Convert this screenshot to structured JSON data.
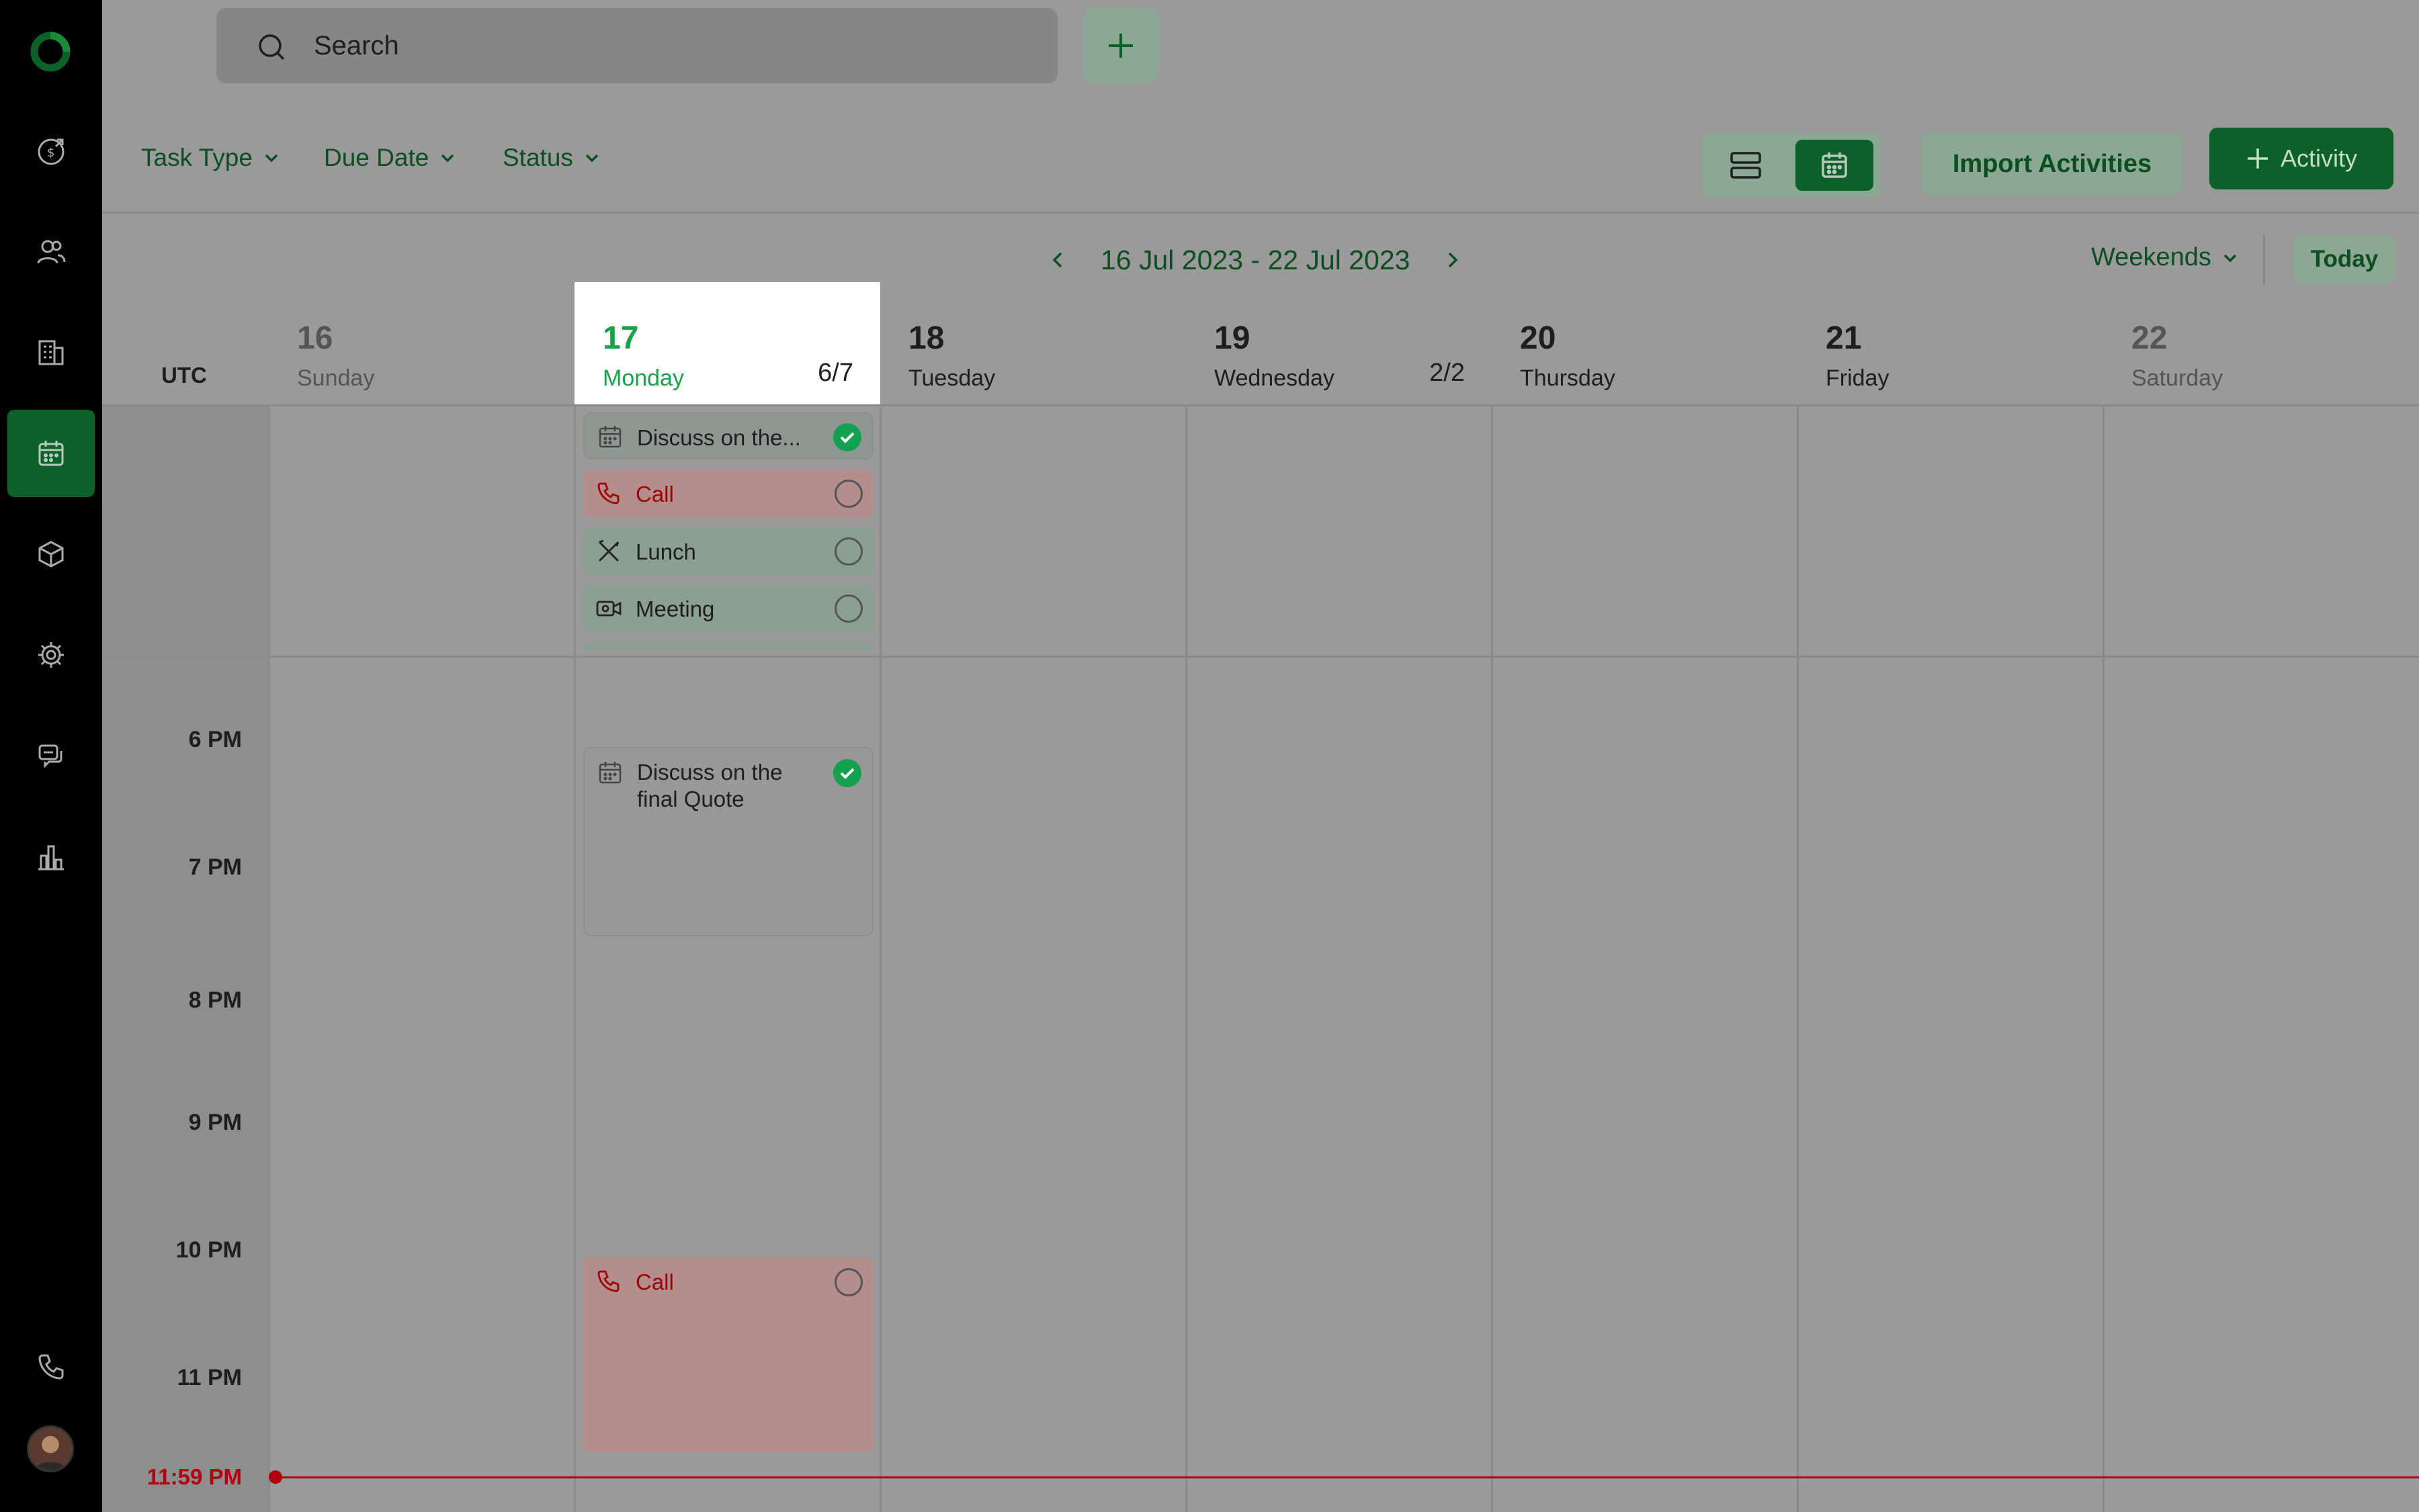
{
  "search": {
    "placeholder": "Search"
  },
  "filters": {
    "task_type": "Task Type",
    "due_date": "Due Date",
    "status": "Status"
  },
  "actions": {
    "import": "Import Activities",
    "activity": "Activity",
    "today": "Today",
    "weekends": "Weekends"
  },
  "calendar": {
    "range": "16 Jul 2023 - 22 Jul 2023",
    "timezone": "UTC",
    "days": [
      {
        "num": "16",
        "name": "Sunday",
        "count": ""
      },
      {
        "num": "17",
        "name": "Monday",
        "count": "6/7"
      },
      {
        "num": "18",
        "name": "Tuesday",
        "count": ""
      },
      {
        "num": "19",
        "name": "Wednesday",
        "count": "2/2"
      },
      {
        "num": "20",
        "name": "Thursday",
        "count": ""
      },
      {
        "num": "21",
        "name": "Friday",
        "count": ""
      },
      {
        "num": "22",
        "name": "Saturday",
        "count": ""
      }
    ],
    "hours": [
      "6 PM",
      "7 PM",
      "8 PM",
      "9 PM",
      "10 PM",
      "11 PM"
    ],
    "now_label": "11:59 PM",
    "allday_events": [
      {
        "title": "Discuss on the...",
        "type": "meeting-calendar",
        "status": "done"
      },
      {
        "title": "Call",
        "type": "call",
        "status": "open"
      },
      {
        "title": "Lunch",
        "type": "lunch",
        "status": "open"
      },
      {
        "title": "Meeting",
        "type": "video",
        "status": "open"
      }
    ],
    "timed_events": [
      {
        "title": "Discuss on the final Quote",
        "type": "meeting-calendar",
        "status": "done"
      },
      {
        "title": "Call",
        "type": "call",
        "status": "open"
      }
    ]
  },
  "colors": {
    "brand": "#0c6128",
    "accent_green": "#16a34a",
    "call_red": "#a00000",
    "now_line": "#b00010"
  }
}
